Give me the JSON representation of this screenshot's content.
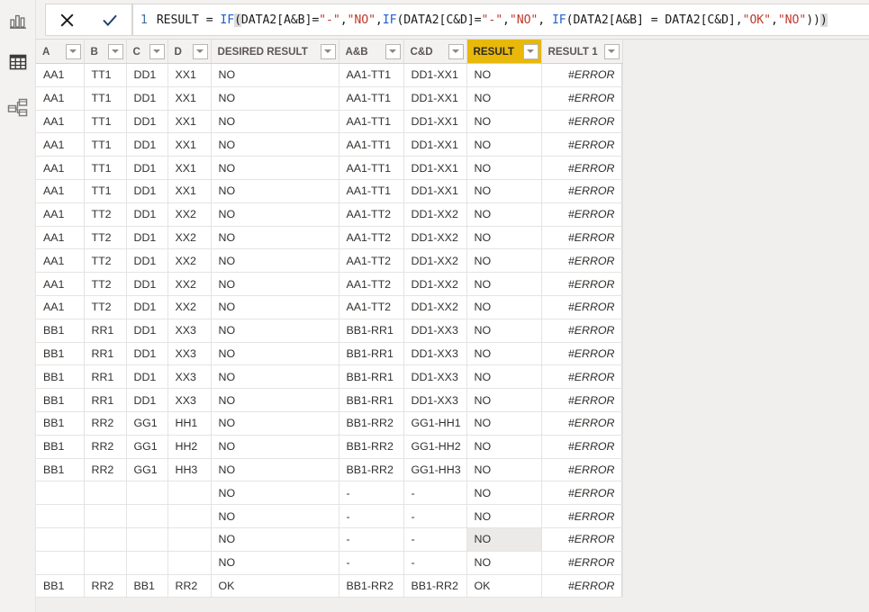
{
  "app": {
    "product": "Power BI Desktop",
    "view": "data-view"
  },
  "rail": {
    "items": [
      {
        "name": "report-view",
        "icon": "bar-chart-icon",
        "selected": false
      },
      {
        "name": "data-view",
        "icon": "table-icon",
        "selected": true
      },
      {
        "name": "model-view",
        "icon": "relationships-icon",
        "selected": false
      }
    ]
  },
  "formula_bar": {
    "cancel_label": "✕",
    "commit_label": "✓",
    "line_number": "1",
    "formula": "RESULT = IF(DATA2[A&B]=\"-\",\"NO\",IF(DATA2[C&D]=\"-\",\"NO\", IF(DATA2[A&B] = DATA2[C&D],\"OK\",\"NO\")))",
    "tokens": [
      {
        "t": "RESULT = ",
        "k": "plain"
      },
      {
        "t": "IF",
        "k": "fn"
      },
      {
        "t": "(",
        "k": "hl"
      },
      {
        "t": "DATA2[A&B]=",
        "k": "plain"
      },
      {
        "t": "\"-\"",
        "k": "str"
      },
      {
        "t": ",",
        "k": "plain"
      },
      {
        "t": "\"NO\"",
        "k": "str"
      },
      {
        "t": ",",
        "k": "plain"
      },
      {
        "t": "IF",
        "k": "fn"
      },
      {
        "t": "(DATA2[C&D]=",
        "k": "plain"
      },
      {
        "t": "\"-\"",
        "k": "str"
      },
      {
        "t": ",",
        "k": "plain"
      },
      {
        "t": "\"NO\"",
        "k": "str"
      },
      {
        "t": ", ",
        "k": "plain"
      },
      {
        "t": "IF",
        "k": "fn"
      },
      {
        "t": "(DATA2[A&B] = DATA2[C&D],",
        "k": "plain"
      },
      {
        "t": "\"OK\"",
        "k": "str"
      },
      {
        "t": ",",
        "k": "plain"
      },
      {
        "t": "\"NO\"",
        "k": "str"
      },
      {
        "t": "))",
        "k": "plain"
      },
      {
        "t": ")",
        "k": "hl"
      }
    ]
  },
  "table": {
    "columns": [
      {
        "key": "a",
        "label": "A",
        "highlight": false,
        "filter": true
      },
      {
        "key": "b",
        "label": "B",
        "highlight": false,
        "filter": true
      },
      {
        "key": "c",
        "label": "C",
        "highlight": false,
        "filter": true
      },
      {
        "key": "d",
        "label": "D",
        "highlight": false,
        "filter": true
      },
      {
        "key": "dr",
        "label": "DESIRED RESULT",
        "highlight": false,
        "filter": true
      },
      {
        "key": "ab",
        "label": "A&B",
        "highlight": false,
        "filter": true
      },
      {
        "key": "cd",
        "label": "C&D",
        "highlight": false,
        "filter": true
      },
      {
        "key": "r",
        "label": "RESULT",
        "highlight": true,
        "filter": true
      },
      {
        "key": "r1",
        "label": "RESULT 1",
        "highlight": false,
        "filter": true
      }
    ],
    "selected_cell": {
      "row": 20,
      "column": "r"
    },
    "rows": [
      {
        "a": "AA1",
        "b": "TT1",
        "c": "DD1",
        "d": "XX1",
        "dr": "NO",
        "ab": "AA1-TT1",
        "cd": "DD1-XX1",
        "r": "NO",
        "r1": "#ERROR"
      },
      {
        "a": "AA1",
        "b": "TT1",
        "c": "DD1",
        "d": "XX1",
        "dr": "NO",
        "ab": "AA1-TT1",
        "cd": "DD1-XX1",
        "r": "NO",
        "r1": "#ERROR"
      },
      {
        "a": "AA1",
        "b": "TT1",
        "c": "DD1",
        "d": "XX1",
        "dr": "NO",
        "ab": "AA1-TT1",
        "cd": "DD1-XX1",
        "r": "NO",
        "r1": "#ERROR"
      },
      {
        "a": "AA1",
        "b": "TT1",
        "c": "DD1",
        "d": "XX1",
        "dr": "NO",
        "ab": "AA1-TT1",
        "cd": "DD1-XX1",
        "r": "NO",
        "r1": "#ERROR"
      },
      {
        "a": "AA1",
        "b": "TT1",
        "c": "DD1",
        "d": "XX1",
        "dr": "NO",
        "ab": "AA1-TT1",
        "cd": "DD1-XX1",
        "r": "NO",
        "r1": "#ERROR"
      },
      {
        "a": "AA1",
        "b": "TT1",
        "c": "DD1",
        "d": "XX1",
        "dr": "NO",
        "ab": "AA1-TT1",
        "cd": "DD1-XX1",
        "r": "NO",
        "r1": "#ERROR"
      },
      {
        "a": "AA1",
        "b": "TT2",
        "c": "DD1",
        "d": "XX2",
        "dr": "NO",
        "ab": "AA1-TT2",
        "cd": "DD1-XX2",
        "r": "NO",
        "r1": "#ERROR"
      },
      {
        "a": "AA1",
        "b": "TT2",
        "c": "DD1",
        "d": "XX2",
        "dr": "NO",
        "ab": "AA1-TT2",
        "cd": "DD1-XX2",
        "r": "NO",
        "r1": "#ERROR"
      },
      {
        "a": "AA1",
        "b": "TT2",
        "c": "DD1",
        "d": "XX2",
        "dr": "NO",
        "ab": "AA1-TT2",
        "cd": "DD1-XX2",
        "r": "NO",
        "r1": "#ERROR"
      },
      {
        "a": "AA1",
        "b": "TT2",
        "c": "DD1",
        "d": "XX2",
        "dr": "NO",
        "ab": "AA1-TT2",
        "cd": "DD1-XX2",
        "r": "NO",
        "r1": "#ERROR"
      },
      {
        "a": "AA1",
        "b": "TT2",
        "c": "DD1",
        "d": "XX2",
        "dr": "NO",
        "ab": "AA1-TT2",
        "cd": "DD1-XX2",
        "r": "NO",
        "r1": "#ERROR"
      },
      {
        "a": "BB1",
        "b": "RR1",
        "c": "DD1",
        "d": "XX3",
        "dr": "NO",
        "ab": "BB1-RR1",
        "cd": "DD1-XX3",
        "r": "NO",
        "r1": "#ERROR"
      },
      {
        "a": "BB1",
        "b": "RR1",
        "c": "DD1",
        "d": "XX3",
        "dr": "NO",
        "ab": "BB1-RR1",
        "cd": "DD1-XX3",
        "r": "NO",
        "r1": "#ERROR"
      },
      {
        "a": "BB1",
        "b": "RR1",
        "c": "DD1",
        "d": "XX3",
        "dr": "NO",
        "ab": "BB1-RR1",
        "cd": "DD1-XX3",
        "r": "NO",
        "r1": "#ERROR"
      },
      {
        "a": "BB1",
        "b": "RR1",
        "c": "DD1",
        "d": "XX3",
        "dr": "NO",
        "ab": "BB1-RR1",
        "cd": "DD1-XX3",
        "r": "NO",
        "r1": "#ERROR"
      },
      {
        "a": "BB1",
        "b": "RR2",
        "c": "GG1",
        "d": "HH1",
        "dr": "NO",
        "ab": "BB1-RR2",
        "cd": "GG1-HH1",
        "r": "NO",
        "r1": "#ERROR"
      },
      {
        "a": "BB1",
        "b": "RR2",
        "c": "GG1",
        "d": "HH2",
        "dr": "NO",
        "ab": "BB1-RR2",
        "cd": "GG1-HH2",
        "r": "NO",
        "r1": "#ERROR"
      },
      {
        "a": "BB1",
        "b": "RR2",
        "c": "GG1",
        "d": "HH3",
        "dr": "NO",
        "ab": "BB1-RR2",
        "cd": "GG1-HH3",
        "r": "NO",
        "r1": "#ERROR"
      },
      {
        "a": "",
        "b": "",
        "c": "",
        "d": "",
        "dr": "NO",
        "ab": "-",
        "cd": "-",
        "r": "NO",
        "r1": "#ERROR"
      },
      {
        "a": "",
        "b": "",
        "c": "",
        "d": "",
        "dr": "NO",
        "ab": "-",
        "cd": "-",
        "r": "NO",
        "r1": "#ERROR"
      },
      {
        "a": "",
        "b": "",
        "c": "",
        "d": "",
        "dr": "NO",
        "ab": "-",
        "cd": "-",
        "r": "NO",
        "r1": "#ERROR"
      },
      {
        "a": "",
        "b": "",
        "c": "",
        "d": "",
        "dr": "NO",
        "ab": "-",
        "cd": "-",
        "r": "NO",
        "r1": "#ERROR"
      },
      {
        "a": "BB1",
        "b": "RR2",
        "c": "BB1",
        "d": "RR2",
        "dr": "OK",
        "ab": "BB1-RR2",
        "cd": "BB1-RR2",
        "r": "OK",
        "r1": "#ERROR"
      }
    ]
  },
  "colors": {
    "header_highlight": "#e8b80b",
    "chrome": "#f3f2f1",
    "canvas": "#f0efee",
    "formula_function": "#1f5fcf",
    "formula_string": "#c0392b"
  }
}
